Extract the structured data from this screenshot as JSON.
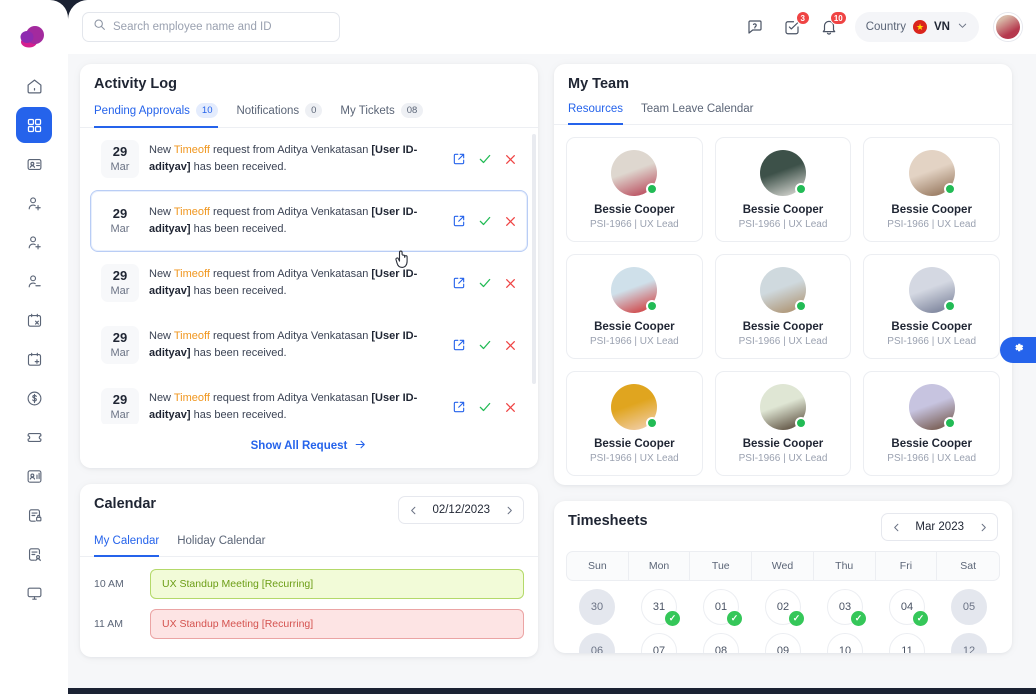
{
  "brand": {
    "logo_icon": "cloud-logo"
  },
  "sidebar": {
    "items": [
      {
        "icon": "home-icon",
        "name": "home",
        "active": false
      },
      {
        "icon": "grid-icon",
        "name": "dashboard",
        "active": true
      },
      {
        "icon": "id-card-icon",
        "name": "employee-directory",
        "active": false
      },
      {
        "icon": "user-add-icon",
        "name": "onboarding",
        "active": false
      },
      {
        "icon": "user-add-icon",
        "name": "recruitment",
        "active": false
      },
      {
        "icon": "user-minus-icon",
        "name": "offboarding",
        "active": false
      },
      {
        "icon": "calendar-x-icon",
        "name": "leave",
        "active": false
      },
      {
        "icon": "calendar-add-icon",
        "name": "schedule",
        "active": false
      },
      {
        "icon": "dollar-circle-icon",
        "name": "payroll",
        "active": false
      },
      {
        "icon": "ticket-icon",
        "name": "tickets",
        "active": false
      },
      {
        "icon": "user-chart-icon",
        "name": "performance",
        "active": false
      },
      {
        "icon": "document-lock-icon",
        "name": "policies",
        "active": false
      },
      {
        "icon": "document-user-icon",
        "name": "reports",
        "active": false
      },
      {
        "icon": "monitor-icon",
        "name": "assets",
        "active": false
      }
    ]
  },
  "topbar": {
    "search": {
      "value": "",
      "placeholder": "Search employee name and ID",
      "icon": "search-icon"
    },
    "help": {
      "icon": "help-chat-icon"
    },
    "tasks": {
      "icon": "task-check-icon",
      "badge": "3"
    },
    "notifications": {
      "icon": "bell-icon",
      "badge": "10"
    },
    "country": {
      "label": "Country",
      "code": "VN",
      "flag": "vietnam-flag",
      "star": "★",
      "chevron": "chevron-down-icon"
    },
    "profile": {
      "icon": "avatar"
    }
  },
  "activity_log": {
    "title": "Activity Log",
    "tabs": [
      {
        "label": "Pending Approvals",
        "count": "10",
        "active": true
      },
      {
        "label": "Notifications",
        "count": "0",
        "active": false
      },
      {
        "label": "My Tickets",
        "count": "08",
        "active": false
      }
    ],
    "rows": [
      {
        "day": "29",
        "month": "Mar",
        "prefix": "New ",
        "type": "Timeoff",
        "mid": " request from Aditya Venkatasan ",
        "uid": "[User ID-adityav]",
        "suffix": " has been received.",
        "selected": false
      },
      {
        "day": "29",
        "month": "Mar",
        "prefix": "New ",
        "type": "Timeoff",
        "mid": " request from Aditya Venkatasan ",
        "uid": "[User ID-adityav]",
        "suffix": " has been received.",
        "selected": true
      },
      {
        "day": "29",
        "month": "Mar",
        "prefix": "New ",
        "type": "Timeoff",
        "mid": " request from Aditya Venkatasan ",
        "uid": "[User ID-adityav]",
        "suffix": " has been received.",
        "selected": false
      },
      {
        "day": "29",
        "month": "Mar",
        "prefix": "New ",
        "type": "Timeoff",
        "mid": " request from Aditya Venkatasan ",
        "uid": "[User ID-adityav]",
        "suffix": " has been received.",
        "selected": false
      },
      {
        "day": "29",
        "month": "Mar",
        "prefix": "New ",
        "type": "Timeoff",
        "mid": " request from Aditya Venkatasan ",
        "uid": "[User ID-adityav]",
        "suffix": " has been received.",
        "selected": false
      }
    ],
    "row_actions": {
      "open": "external-link-icon",
      "approve": "check-icon",
      "reject": "x-icon"
    },
    "show_all": "Show All Request",
    "show_all_icon": "arrow-right-icon"
  },
  "my_team": {
    "title": "My Team",
    "tabs": [
      {
        "label": "Resources",
        "active": true
      },
      {
        "label": "Team Leave Calendar",
        "active": false
      }
    ],
    "members": [
      {
        "name": "Bessie Cooper",
        "meta": "PSI-1966 | UX Lead",
        "status": "online",
        "avatar_colors": [
          "#ded7cf",
          "#b5384d"
        ]
      },
      {
        "name": "Bessie Cooper",
        "meta": "PSI-1966 | UX Lead",
        "status": "online",
        "avatar_colors": [
          "#3d5149",
          "#e8e6e1"
        ]
      },
      {
        "name": "Bessie Cooper",
        "meta": "PSI-1966 | UX Lead",
        "status": "online",
        "avatar_colors": [
          "#e3d3c4",
          "#8b6a4f"
        ]
      },
      {
        "name": "Bessie Cooper",
        "meta": "PSI-1966 | UX Lead",
        "status": "online",
        "avatar_colors": [
          "#cfe0ea",
          "#d12b2b"
        ]
      },
      {
        "name": "Bessie Cooper",
        "meta": "PSI-1966 | UX Lead",
        "status": "online",
        "avatar_colors": [
          "#cfd9de",
          "#a98a63"
        ]
      },
      {
        "name": "Bessie Cooper",
        "meta": "PSI-1966 | UX Lead",
        "status": "online",
        "avatar_colors": [
          "#d4d8e2",
          "#6e7690"
        ]
      },
      {
        "name": "Bessie Cooper",
        "meta": "PSI-1966 | UX Lead",
        "status": "online",
        "avatar_colors": [
          "#e0a51f",
          "#f3d3ba"
        ]
      },
      {
        "name": "Bessie Cooper",
        "meta": "PSI-1966 | UX Lead",
        "status": "online",
        "avatar_colors": [
          "#dfe6d4",
          "#4a3a2a"
        ]
      },
      {
        "name": "Bessie Cooper",
        "meta": "PSI-1966 | UX Lead",
        "status": "online",
        "avatar_colors": [
          "#c7c4e0",
          "#6a4a38"
        ]
      },
      {
        "name": "Bessie Cooper",
        "meta": "PSI-1966 | UX Lead",
        "status": "online",
        "avatar_colors": [
          "#e6b32a",
          "#f0d8c0"
        ]
      },
      {
        "name": "Bessie Cooper",
        "meta": "PSI-1966 | UX Lead",
        "status": "online",
        "avatar_colors": [
          "#dadfd2",
          "#3a3a3a"
        ]
      },
      {
        "name": "Bessie Cooper",
        "meta": "PSI-1966 | UX Lead",
        "status": "online",
        "avatar_colors": [
          "#cdc9e3",
          "#5a4030"
        ]
      }
    ]
  },
  "calendar": {
    "title": "Calendar",
    "date": "02/12/2023",
    "prev_icon": "chevron-left-icon",
    "next_icon": "chevron-right-icon",
    "tabs": [
      {
        "label": "My Calendar",
        "active": true
      },
      {
        "label": "Holiday Calendar",
        "active": false
      }
    ],
    "events": [
      {
        "time": "10 AM",
        "title": "UX Standup Meeting [Recurring]",
        "color": "green"
      },
      {
        "time": "11 AM",
        "title": "UX Standup Meeting [Recurring]",
        "color": "red"
      }
    ]
  },
  "timesheets": {
    "title": "Timesheets",
    "month": "Mar 2023",
    "prev_icon": "chevron-left-icon",
    "next_icon": "chevron-right-icon",
    "day_headers": [
      "Sun",
      "Mon",
      "Tue",
      "Wed",
      "Thu",
      "Fri",
      "Sat"
    ],
    "weeks": [
      [
        {
          "day": "30",
          "weekend": true,
          "checked": false
        },
        {
          "day": "31",
          "weekend": false,
          "checked": true
        },
        {
          "day": "01",
          "weekend": false,
          "checked": true
        },
        {
          "day": "02",
          "weekend": false,
          "checked": true
        },
        {
          "day": "03",
          "weekend": false,
          "checked": true
        },
        {
          "day": "04",
          "weekend": false,
          "checked": true
        },
        {
          "day": "05",
          "weekend": true,
          "checked": false
        }
      ],
      [
        {
          "day": "06",
          "weekend": true,
          "checked": false
        },
        {
          "day": "07",
          "weekend": false,
          "checked": false
        },
        {
          "day": "08",
          "weekend": false,
          "checked": false
        },
        {
          "day": "09",
          "weekend": false,
          "checked": false
        },
        {
          "day": "10",
          "weekend": false,
          "checked": false
        },
        {
          "day": "11",
          "weekend": false,
          "checked": false
        },
        {
          "day": "12",
          "weekend": true,
          "checked": false
        }
      ]
    ],
    "check_glyph": "✓"
  },
  "fab": {
    "icon": "gear-icon"
  },
  "colors": {
    "accent": "#2563eb",
    "warning": "#f0961e",
    "success": "#22bb55",
    "danger": "#ef4444",
    "surface": "#f6f7f9",
    "shell": "#1b2233"
  }
}
